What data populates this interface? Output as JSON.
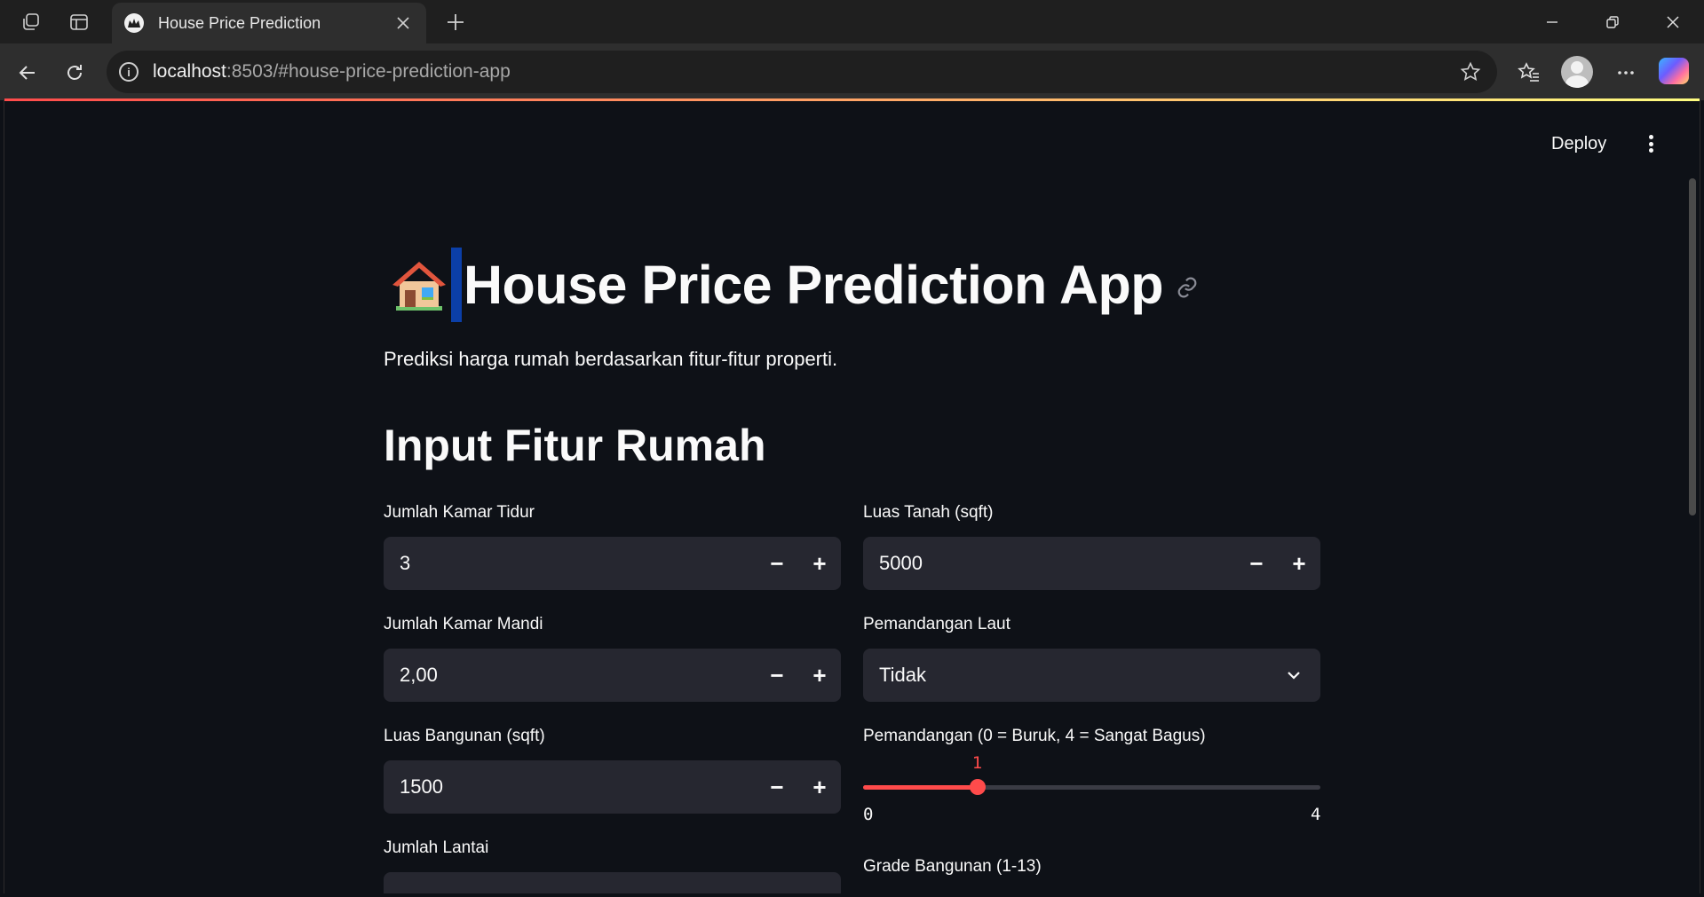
{
  "browser": {
    "tab_title": "House Price Prediction",
    "url_host": "localhost",
    "url_rest": ":8503/#house-price-prediction-app"
  },
  "toolbar": {
    "deploy_label": "Deploy"
  },
  "page": {
    "title_emoji": "🏠",
    "title": "House Price Prediction App",
    "subtitle": "Prediksi harga rumah berdasarkan fitur-fitur properti.",
    "section_heading": "Input Fitur Rumah"
  },
  "form": {
    "bedrooms": {
      "label": "Jumlah Kamar Tidur",
      "value": "3"
    },
    "bathrooms": {
      "label": "Jumlah Kamar Mandi",
      "value": "2,00"
    },
    "living_area": {
      "label": "Luas Bangunan (sqft)",
      "value": "1500"
    },
    "floors": {
      "label": "Jumlah Lantai"
    },
    "lot_area": {
      "label": "Luas Tanah (sqft)",
      "value": "5000"
    },
    "waterfront": {
      "label": "Pemandangan Laut",
      "value": "Tidak"
    },
    "view": {
      "label": "Pemandangan (0 = Buruk, 4 = Sangat Bagus)",
      "value": 1,
      "value_label": "1",
      "min": 0,
      "max": 4,
      "min_label": "0",
      "max_label": "4"
    },
    "grade": {
      "label": "Grade Bangunan (1-13)"
    }
  },
  "colors": {
    "accent": "#ff4b4b",
    "background": "#0e1117",
    "input_bg": "#262730"
  }
}
